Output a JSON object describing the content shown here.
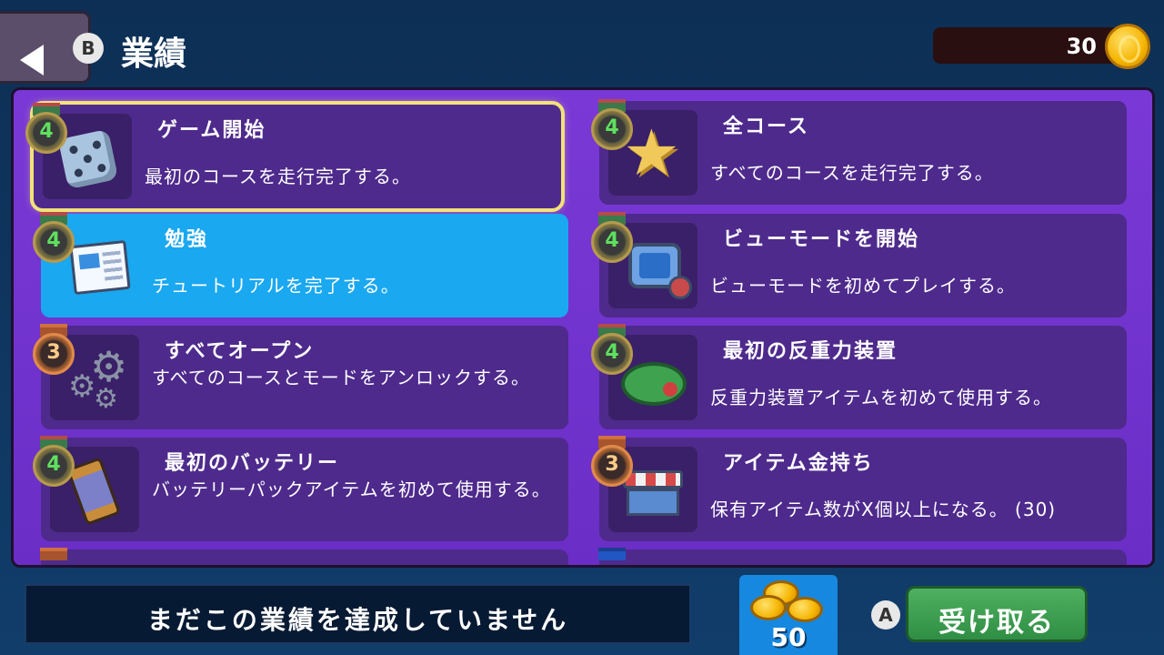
{
  "header": {
    "back_button_hint": "B",
    "title": "業績",
    "coins": "30"
  },
  "achievements": [
    {
      "title": "ゲーム開始",
      "description": "最初のコースを走行完了する。",
      "medal": "4",
      "icon": "dice-icon"
    },
    {
      "title": "全コース",
      "description": "すべてのコースを走行完了する。",
      "medal": "4",
      "icon": "star-icon"
    },
    {
      "title": "勉強",
      "description": "チュートリアルを完了する。",
      "medal": "4",
      "icon": "newspaper-icon"
    },
    {
      "title": "ビューモードを開始",
      "description": "ビューモードを初めてプレイする。",
      "medal": "4",
      "icon": "tv-icon"
    },
    {
      "title": "すべてオープン",
      "description": "すべてのコースとモードをアンロックする。",
      "medal": "3",
      "icon": "gears-icon"
    },
    {
      "title": "最初の反重力装置",
      "description": "反重力装置アイテムを初めて使用する。",
      "medal": "4",
      "icon": "anti-gravity-icon"
    },
    {
      "title": "最初のバッテリー",
      "description": "バッテリーパックアイテムを初めて使用する。",
      "medal": "4",
      "icon": "battery-icon"
    },
    {
      "title": "アイテム金持ち",
      "description": "保有アイテム数がX個以上になる。 (30)",
      "medal": "3",
      "icon": "shop-icon"
    }
  ],
  "footer": {
    "status": "まだこの業績を達成していません",
    "reward": "50",
    "claim_hint": "A",
    "claim_label": "受け取る"
  },
  "colors": {
    "panel": "#7a39d6",
    "card": "#4e2a8c",
    "card_selected": "#1aa8f0",
    "focus_outline": "#f1e27a",
    "claim_button": "#3ea04f"
  }
}
